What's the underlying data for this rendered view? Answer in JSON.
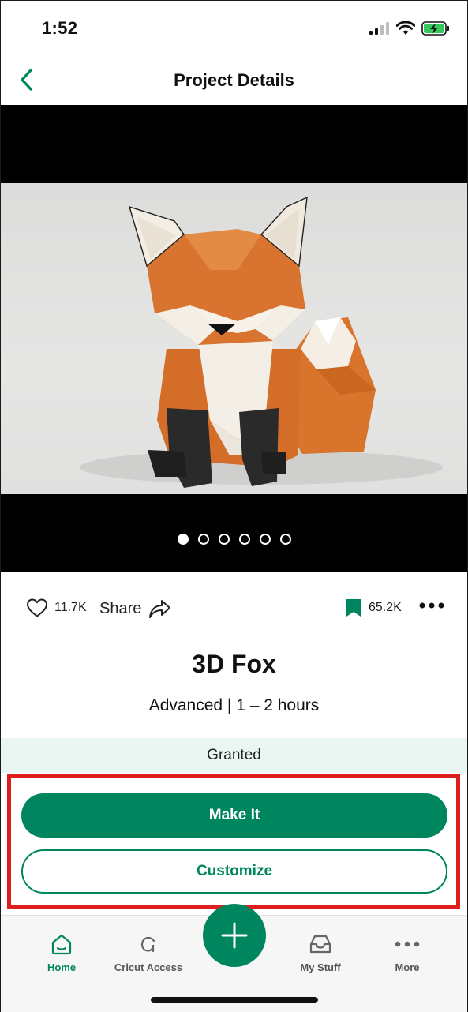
{
  "status_bar": {
    "time": "1:52"
  },
  "nav": {
    "title": "Project Details"
  },
  "carousel": {
    "total": 6,
    "active_index": 0
  },
  "stats": {
    "likes": "11.7K",
    "share_label": "Share",
    "saves": "65.2K"
  },
  "project": {
    "title": "3D Fox",
    "meta": "Advanced | 1 – 2 hours",
    "access_status": "Granted"
  },
  "cta": {
    "primary": "Make It",
    "secondary": "Customize"
  },
  "tabs": [
    {
      "label": "Home",
      "icon": "home-icon"
    },
    {
      "label": "Cricut Access",
      "icon": "cricut-access-icon"
    },
    {
      "label": "My Stuff",
      "icon": "inbox-icon"
    },
    {
      "label": "More",
      "icon": "more-dots-icon"
    }
  ],
  "colors": {
    "accent": "#00865f",
    "highlight": "#e01d1d",
    "granted_bg": "#e9f6f1"
  }
}
